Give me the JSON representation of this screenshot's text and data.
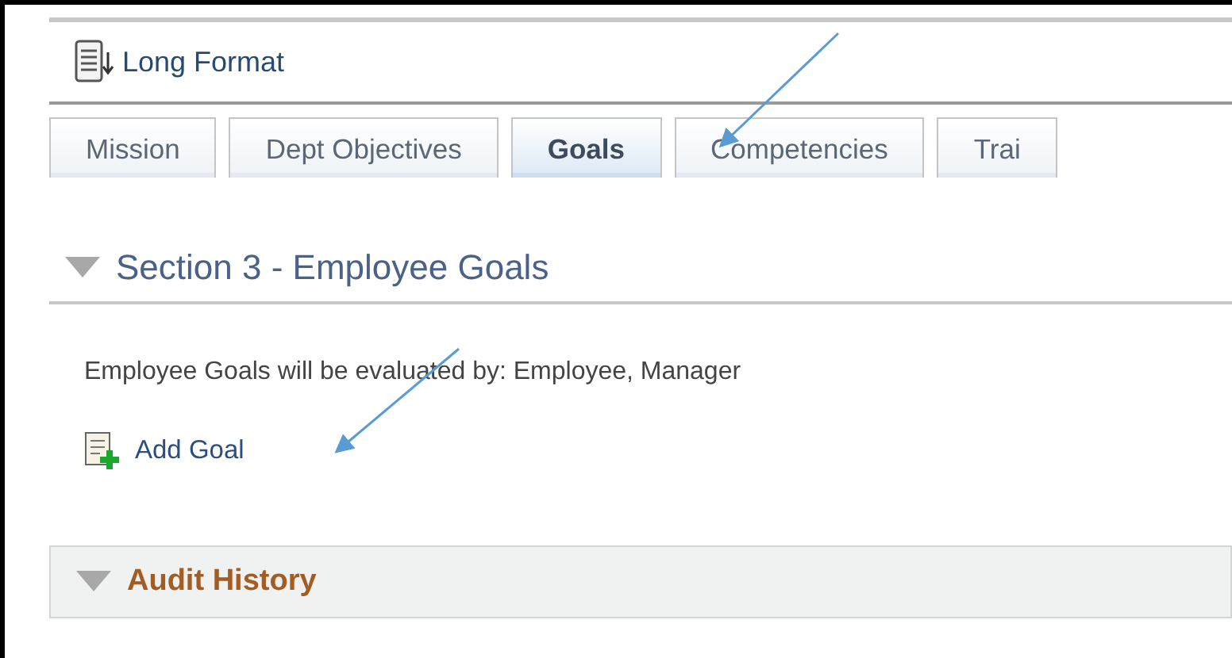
{
  "header": {
    "title": "Long Format"
  },
  "tabs": [
    {
      "label": "Mission",
      "selected": false
    },
    {
      "label": "Dept Objectives",
      "selected": false
    },
    {
      "label": "Goals",
      "selected": true
    },
    {
      "label": "Competencies",
      "selected": false
    },
    {
      "label": "Trai",
      "selected": false
    }
  ],
  "section": {
    "title": "Section 3 - Employee Goals",
    "expanded": true,
    "description": "Employee Goals will be evaluated by: Employee, Manager",
    "action": "Add Goal"
  },
  "audit": {
    "title": "Audit History",
    "expanded": true
  }
}
